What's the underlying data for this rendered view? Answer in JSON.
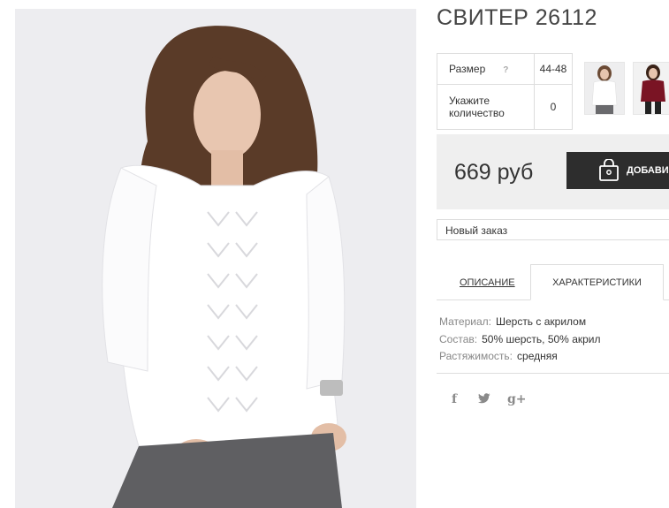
{
  "product": {
    "title": "СВИТЕР 26112",
    "options": [
      {
        "label": "Размер",
        "help_icon": "?",
        "value": "44-48"
      },
      {
        "label_line1": "Укажите",
        "label_line2": "количество",
        "value": "0"
      }
    ],
    "price": "669 руб",
    "add_button_label": "ДОБАВИ",
    "order_select": "Новый заказ"
  },
  "tabs": [
    {
      "label": "ОПИСАНИЕ",
      "active": false
    },
    {
      "label": "ХАРАКТЕРИСТИКИ",
      "active": true
    }
  ],
  "specs": [
    {
      "key": "Материал:",
      "value": "Шерсть с акрилом"
    },
    {
      "key": "Состав:",
      "value": "50% шерсть, 50% акрил"
    },
    {
      "key": "Растяжимость:",
      "value": "средняя"
    }
  ],
  "social": {
    "facebook": "f",
    "twitter": "t",
    "google": "g+"
  },
  "icons": [
    "help-icon",
    "shopping-bag-icon",
    "facebook-icon",
    "twitter-icon",
    "google-plus-icon"
  ],
  "colors": {
    "button_bg": "#2d2d2d",
    "price_box_bg": "#efefef",
    "thumb_2": "#7a1424"
  }
}
